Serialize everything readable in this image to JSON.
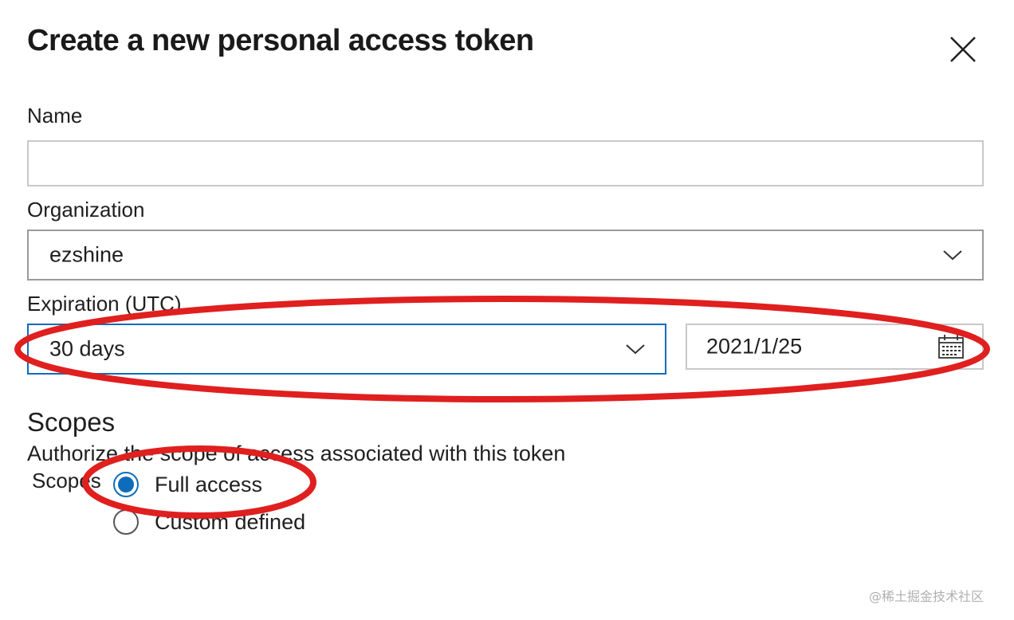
{
  "dialog": {
    "title": "Create a new personal access token",
    "close_icon": "close-icon"
  },
  "form": {
    "name": {
      "label": "Name",
      "value": ""
    },
    "organization": {
      "label": "Organization",
      "value": "ezshine"
    },
    "expiration": {
      "label": "Expiration (UTC)",
      "duration": "30 days",
      "date": "2021/1/25",
      "calendar_icon": "calendar-icon"
    }
  },
  "scopes": {
    "title": "Scopes",
    "description": "Authorize the scope of access associated with this token",
    "label": "Scopes",
    "options": [
      {
        "label": "Full access",
        "selected": true
      },
      {
        "label": "Custom defined",
        "selected": false
      }
    ]
  },
  "watermark": "@稀土掘金技术社区",
  "colors": {
    "accent": "#0f6cbd",
    "annotation": "#e01f1f"
  }
}
